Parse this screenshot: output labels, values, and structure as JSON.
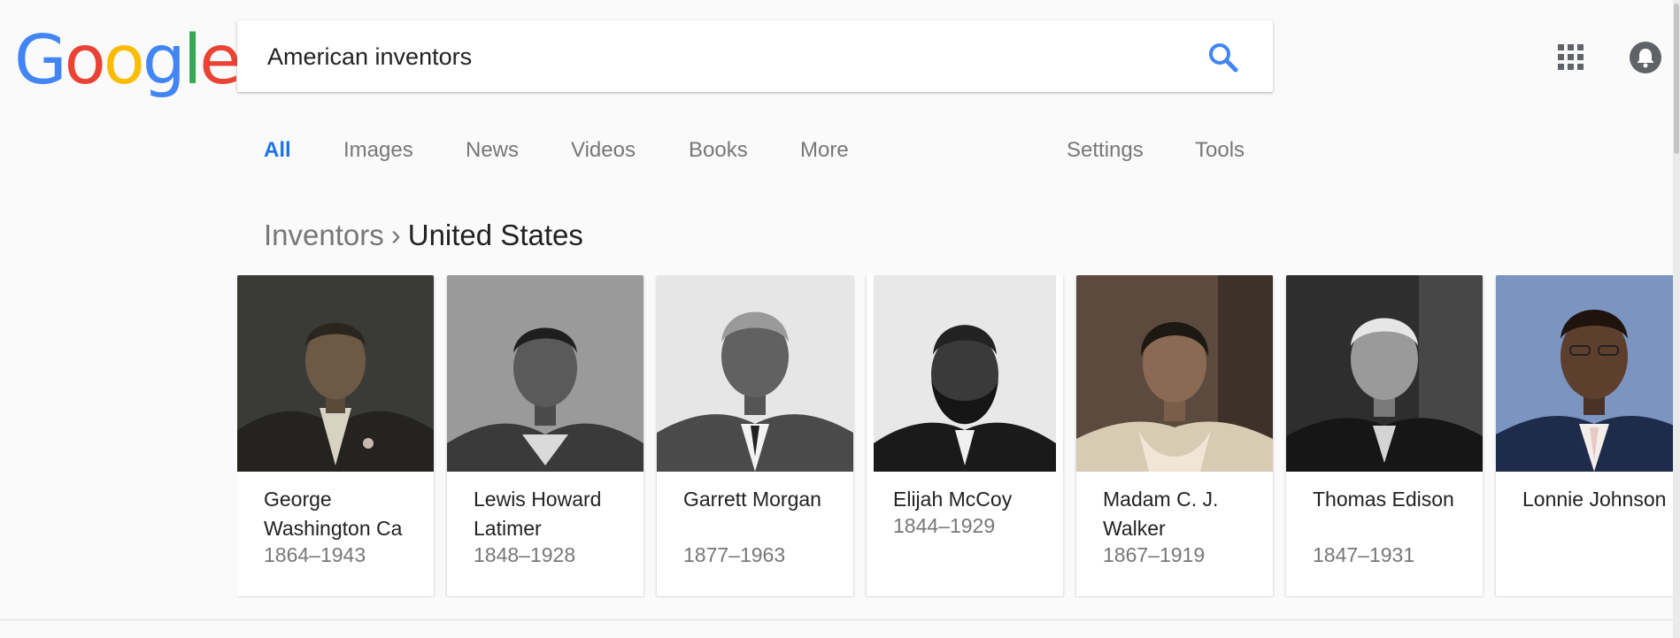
{
  "logo": {
    "letters": [
      {
        "ch": "G",
        "color": "#4285f4"
      },
      {
        "ch": "o",
        "color": "#ea4335"
      },
      {
        "ch": "o",
        "color": "#fbbc05"
      },
      {
        "ch": "g",
        "color": "#4285f4"
      },
      {
        "ch": "l",
        "color": "#34a853"
      },
      {
        "ch": "e",
        "color": "#ea4335"
      }
    ]
  },
  "search": {
    "value": "American inventors"
  },
  "header_icons": {
    "apps": "apps-grid-icon",
    "notifications": "notifications-bell-icon"
  },
  "tabs": [
    {
      "label": "All",
      "active": true
    },
    {
      "label": "Images"
    },
    {
      "label": "News"
    },
    {
      "label": "Videos"
    },
    {
      "label": "Books"
    },
    {
      "label": "More"
    },
    {
      "label": "Settings"
    },
    {
      "label": "Tools"
    }
  ],
  "breadcrumb": {
    "parent": "Inventors",
    "separator": "›",
    "current": "United States"
  },
  "inventors": [
    {
      "name": "George Washington Ca",
      "years": "1864–1943"
    },
    {
      "name": "Lewis Howard Latimer",
      "years": "1848–1928"
    },
    {
      "name": "Garrett Morgan",
      "years": "1877–1963"
    },
    {
      "name": "Elijah McCoy",
      "years": "1844–1929"
    },
    {
      "name": "Madam C. J. Walker",
      "years": "1867–1919"
    },
    {
      "name": "Thomas Edison",
      "years": "1847–1931"
    },
    {
      "name": "Lonnie Johnson",
      "years": ""
    }
  ],
  "colors": {
    "accent": "#1a73e8",
    "muted": "#777777",
    "text": "#222222",
    "page_bg": "#fafafa"
  }
}
